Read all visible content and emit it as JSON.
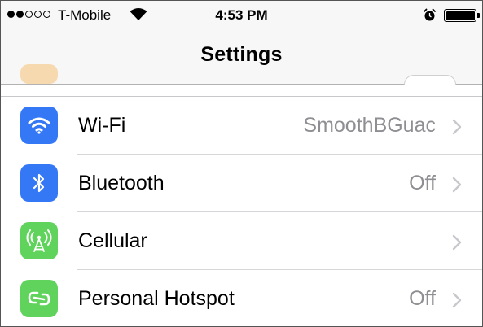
{
  "status_bar": {
    "signal_dots": [
      true,
      true,
      false,
      false,
      false
    ],
    "carrier": "T-Mobile",
    "time": "4:53 PM",
    "icons": [
      "wifi-icon",
      "alarm-icon",
      "battery-icon"
    ],
    "battery_level": 1.0
  },
  "nav": {
    "title": "Settings"
  },
  "settings": {
    "items": [
      {
        "label": "Wi-Fi",
        "value": "SmoothBGuac",
        "icon": "wifi-icon",
        "color": "#3478f6"
      },
      {
        "label": "Bluetooth",
        "value": "Off",
        "icon": "bluetooth-icon",
        "color": "#3478f6"
      },
      {
        "label": "Cellular",
        "value": "",
        "icon": "cellular-antenna-icon",
        "color": "#5fd35b"
      },
      {
        "label": "Personal Hotspot",
        "value": "Off",
        "icon": "hotspot-link-icon",
        "color": "#5fd35b"
      }
    ]
  },
  "colors": {
    "accent_blue": "#3478f6",
    "accent_green": "#5fd35b",
    "secondary_text": "#8e8e93",
    "chevron": "#c7c7cc"
  }
}
